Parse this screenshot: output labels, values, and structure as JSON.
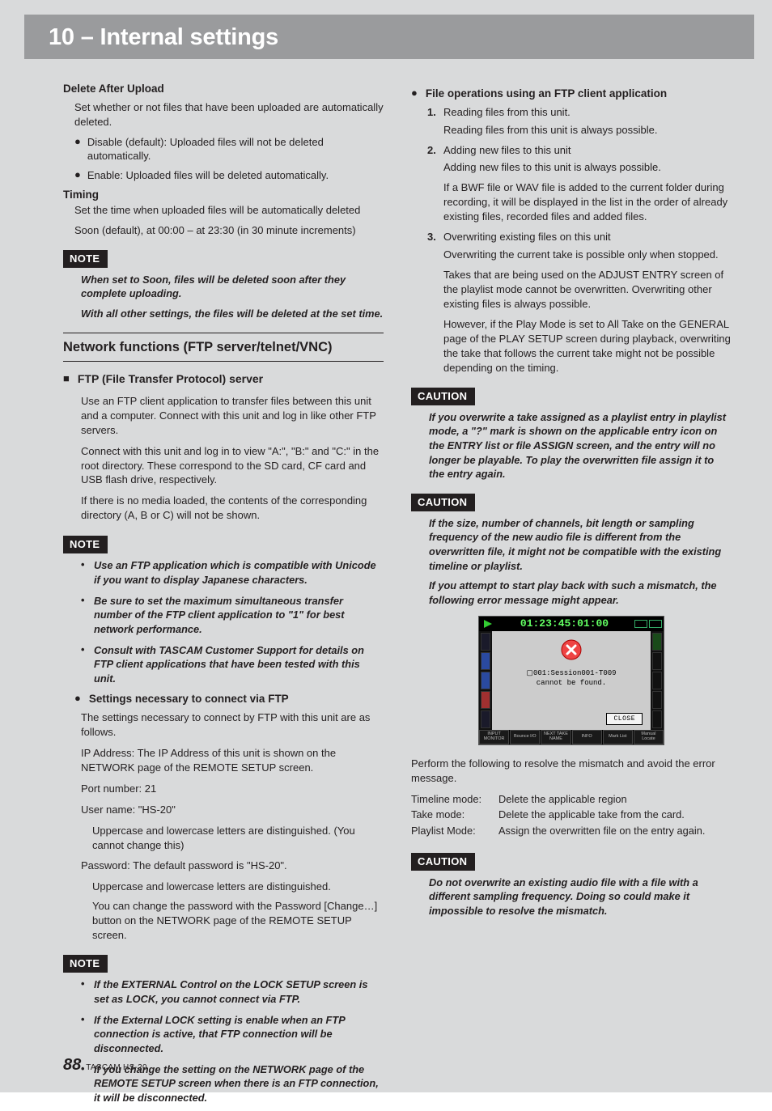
{
  "titleBar": "10 – Internal settings",
  "left": {
    "deleteAfterUpload": {
      "heading": "Delete After Upload",
      "desc": "Set whether or not files that have been uploaded are automatically deleted.",
      "opts": [
        "Disable (default): Uploaded files will not be deleted automatically.",
        "Enable: Uploaded files will be deleted automatically."
      ]
    },
    "timing": {
      "heading": "Timing",
      "desc": "Set the time when uploaded files will be automatically deleted",
      "line2": "Soon (default), at 00:00 – at 23:30 (in 30 minute increments)"
    },
    "note1": {
      "label": "NOTE",
      "items": [
        "When set to Soon, files will be deleted soon after they complete uploading.",
        "With all other settings, the files will be deleted at the set time."
      ]
    },
    "h2": "Network functions (FTP server/telnet/VNC)",
    "ftpHead": "FTP (File Transfer Protocol) server",
    "ftpParas": [
      "Use an FTP client application to transfer files between this unit and a computer. Connect with this unit and log in like other FTP servers.",
      "Connect with this unit and log in to view \"A:\", \"B:\" and \"C:\" in the root directory. These correspond to the SD card, CF card and USB flash drive, respectively.",
      "If there is no media loaded, the contents of the corresponding directory (A, B or C) will not be shown."
    ],
    "note2": {
      "label": "NOTE",
      "items": [
        "Use an FTP application which is compatible with Unicode if you want to display Japanese characters.",
        "Be sure to set the maximum simultaneous transfer number of the FTP client application to \"1\" for best network performance.",
        "Consult with TASCAM Customer Support for details on FTP client applications that have been tested with this unit."
      ]
    },
    "settingsHead": "Settings necessary to connect via FTP",
    "settingsDesc": "The settings necessary to connect by FTP with this unit are as follows.",
    "ip": "IP Address: The IP Address of this unit is shown on the NETWORK page of the REMOTE SETUP screen.",
    "port": "Port number: 21",
    "user": "User name: \"HS-20\"",
    "userNote": "Uppercase and lowercase letters are distinguished. (You cannot change this)",
    "pw": "Password: The default password is \"HS-20\".",
    "pwNote1": "Uppercase and lowercase letters are distinguished.",
    "pwNote2": "You can change the password with the Password [Change…] button on the NETWORK page of the REMOTE SETUP screen.",
    "note3": {
      "label": "NOTE",
      "items": [
        "If the EXTERNAL Control on the LOCK SETUP screen is set as LOCK, you cannot connect via FTP.",
        "If the External LOCK setting is enable when an FTP connection is active, that FTP connection will be disconnected.",
        "If you change the setting on the NETWORK page of the REMOTE SETUP screen when there is an FTP connection, it will be disconnected."
      ]
    }
  },
  "right": {
    "fileOpsHead": "File operations using an FTP client application",
    "ops": [
      {
        "n": "1",
        "head": "Reading files from this unit.",
        "body": [
          "Reading files from this unit is always possible."
        ]
      },
      {
        "n": "2",
        "head": "Adding new files to this unit",
        "body": [
          "Adding new files to this unit is always possible.",
          "If a BWF file or WAV file is added to the current folder during recording, it will be displayed in the list in the order of already existing files, recorded files and added files."
        ]
      },
      {
        "n": "3",
        "head": "Overwriting existing files on this unit",
        "body": [
          "Overwriting the current take is possible only when stopped.",
          "Takes that are being used on the ADJUST ENTRY screen of the playlist mode cannot be overwritten. Overwriting other existing files is always possible.",
          "However, if the Play Mode is set to All Take on the GENERAL page of the PLAY SETUP screen during playback, overwriting the take that follows the current take might not be possible depending on the timing."
        ]
      }
    ],
    "caution1": {
      "label": "CAUTION",
      "text": "If you overwrite a take assigned as a playlist entry in playlist mode, a \"?\" mark is shown on the applicable entry icon on the ENTRY list or file ASSIGN screen, and the entry will no longer be playable. To play the overwritten file assign it to the entry again."
    },
    "caution2": {
      "label": "CAUTION",
      "text1": "If the size, number of channels, bit length or sampling frequency of the new audio file is different from the overwritten file, it might not be compatible with the existing timeline or playlist.",
      "text2": "If you attempt to start play back with such a mismatch, the following error message might appear."
    },
    "screenshot": {
      "time": "01:23:45:01:00",
      "line1": "001:Session001-T009",
      "line2": "cannot be found.",
      "close": "CLOSE",
      "bottom": [
        "INPUT MONITOR",
        "Bounce I/O",
        "NEXT TAKE NAME",
        "INFO",
        "Mark List",
        "Manual Locate"
      ]
    },
    "resolveLead": "Perform the following to resolve the mismatch and avoid the error message.",
    "resolve": [
      {
        "k": "Timeline mode:",
        "v": "Delete the applicable region"
      },
      {
        "k": "Take mode:",
        "v": "Delete the applicable take from the card."
      },
      {
        "k": "Playlist Mode:",
        "v": "Assign the overwritten file on the entry again."
      }
    ],
    "caution3": {
      "label": "CAUTION",
      "text": "Do not overwrite an existing audio file with a file with a different sampling frequency. Doing so could make it impossible to resolve the mismatch."
    }
  },
  "footer": {
    "page": "88",
    "model": "TASCAM HS-20"
  }
}
